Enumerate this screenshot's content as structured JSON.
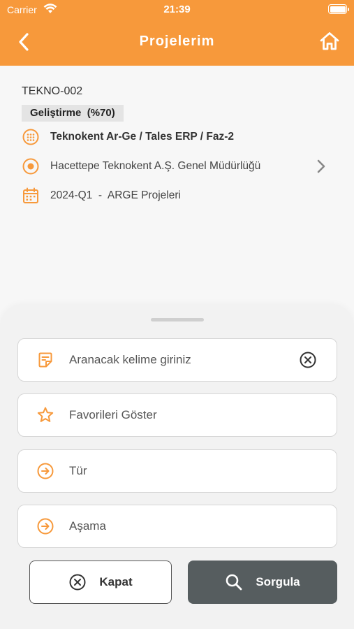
{
  "status_bar": {
    "carrier": "Carrier",
    "time": "21:39",
    "battery_level": 1.0,
    "wifi_icon": "wifi-icon",
    "battery_icon": "battery-icon"
  },
  "header": {
    "title": "Projelerim",
    "back_icon": "chevron-left-icon",
    "home_icon": "home-icon",
    "background_color": "#f7993b"
  },
  "project": {
    "code": "TEKNO-002",
    "phase_badge": "Geliştirme  (%70)",
    "details": [
      {
        "icon": "grid-circle-icon",
        "text": "Teknokent Ar-Ge / Tales ERP / Faz-2",
        "bold": true
      },
      {
        "icon": "target-circle-icon",
        "text": "Hacettepe Teknokent A.Ş. Genel Müdürlüğü",
        "has_chevron": true
      },
      {
        "icon": "calendar-icon",
        "text": "2024-Q1  -  ARGE Projeleri"
      }
    ]
  },
  "filter_sheet": {
    "search": {
      "placeholder": "Aranacak kelime giriniz",
      "value": "",
      "icon": "note-icon",
      "clear_icon": "clear-circle-icon"
    },
    "favorites": {
      "label": "Favorileri Göster",
      "icon": "star-icon"
    },
    "type": {
      "label": "Tür",
      "icon": "arrow-circle-icon"
    },
    "stage": {
      "label": "Aşama",
      "icon": "arrow-circle-icon"
    },
    "close_button": {
      "label": "Kapat",
      "icon": "close-circle-icon"
    },
    "query_button": {
      "label": "Sorgula",
      "icon": "search-icon"
    }
  },
  "colors": {
    "accent": "#f7993b",
    "primary_button": "#565d5f"
  }
}
